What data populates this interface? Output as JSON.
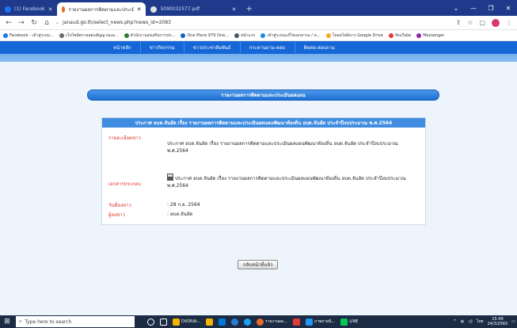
{
  "browser": {
    "tabs": [
      {
        "label": "(1) Facebook",
        "color": "#1877f2",
        "active": false
      },
      {
        "label": "รายงานผลการติดตามและประเมินแผนพัฒนาท้องถิ่น อบต.จันอัด",
        "color": "#e66c2c",
        "active": true
      },
      {
        "label": "5090032577.pdf",
        "color": "#e0e0e0",
        "active": false
      }
    ],
    "new_tab": "+",
    "url": "janaud.go.th/select_news.php?news_id=2083",
    "bookmarks": [
      {
        "label": "Facebook - เข้าสู่ระบบ...",
        "color": "#1877f2"
      },
      {
        "label": "เว็บไซต์ตรวจสอบสัญญาณเน...",
        "color": "#6a6a6a"
      },
      {
        "label": "สำนักงานส่งเสริมการปก...",
        "color": "#2e7d32"
      },
      {
        "label": "One Piece 979 One...",
        "color": "#1565c0"
      },
      {
        "label": "หน้าแรก",
        "color": "#455a64"
      },
      {
        "label": "เข้าสู่ระบบแก้ไขเอกสารอ / ห...",
        "color": "#1e88e5"
      },
      {
        "label": "โหลดไฟล์จาก Google Drive",
        "color": "#f9a825"
      },
      {
        "label": "YouTube",
        "color": "#e53935"
      },
      {
        "label": "Messenger",
        "color": "#8e24aa"
      }
    ]
  },
  "site": {
    "nav": [
      "หน้าหลัก",
      "ข่าวกิจกรรม",
      "ข่าวประชาสัมพันธ์",
      "กระดานถาม-ตอบ",
      "ติดต่อ-สอบถาม"
    ],
    "section_title": "รายงานผลการติดตามและประเมินผลแผน",
    "detail": {
      "heading": "ประกาศ อบต.จันอัด เรื่อง รายงานผลการติดตามและประเมินผลแผนพัฒนาท้องถิ่น อบต.จันอัด ประจำปีงบประมาณ พ.ศ.2564",
      "detail_label": "รายละเอียดข่าว",
      "detail_value": "ประกาศ อบต.จันอัด เรื่อง รายงานผลการติดตามและประเมินผลแผนพัฒนาท้องถิ่น อบต.จันอัด ประจำปีงบประมาณ พ.ศ.2564",
      "attachment_label": "เอกสารประกอบ",
      "attachment_value": "ประกาศ อบต.จันอัด เรื่อง รายงานผลการติดตามและประเมินผลแผนพัฒนาท้องถิ่น อบต.จันอัด ประจำปีงบประมาณ พ.ศ.2564",
      "date_label": "วันที่ลงข่าว",
      "date_value": ": 28 ก.ย. 2564",
      "poster_label": "ผู้ลงข่าว",
      "poster_value": ": อบต.จันอัด"
    },
    "back_button": "กลับหน้าที่แล้ว"
  },
  "taskbar": {
    "search_placeholder": "Type here to search",
    "apps": [
      {
        "label": "",
        "color": "#ffffff"
      },
      {
        "label": "",
        "color": "#ffffff"
      },
      {
        "label": "DVDRiA...",
        "color": "#f4b400"
      },
      {
        "label": "",
        "color": "#0078d7"
      },
      {
        "label": "",
        "color": "#e0463f"
      },
      {
        "label": "",
        "color": "#2b7cd3"
      },
      {
        "label": "",
        "color": "#1da1f2"
      },
      {
        "label": "รายงานผล...",
        "color": "#e66c2c"
      },
      {
        "label": "",
        "color": "#e53935"
      },
      {
        "label": "ภาพถ่ายนิ่...",
        "color": "#2196f3"
      },
      {
        "label": "LINE",
        "color": "#06c755"
      }
    ],
    "time": "15:49",
    "date": "24/3/2565",
    "lang": "ไทย"
  }
}
